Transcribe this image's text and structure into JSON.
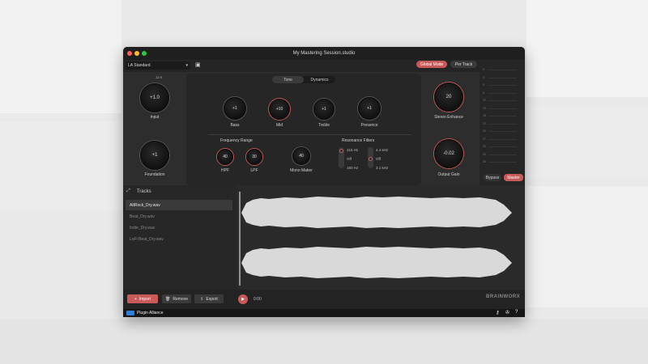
{
  "window": {
    "title": "My Mastering Session.studio"
  },
  "topbar": {
    "preset": "LA Standard",
    "mode_global": "Global Mode",
    "mode_per_track": "Per Track"
  },
  "left": {
    "input": {
      "value": "+1.0",
      "label": "Input",
      "scale": "12.5"
    },
    "foundation": {
      "value": "+1",
      "label": "Foundation"
    }
  },
  "center": {
    "tabs": [
      "Tone",
      "Dynamics"
    ],
    "tone_knobs": [
      {
        "value": "+1",
        "label": "Bass"
      },
      {
        "value": "+10",
        "label": "Mid"
      },
      {
        "value": "+1",
        "label": "Treble"
      },
      {
        "value": "+1",
        "label": "Presence"
      }
    ],
    "frequency_range": {
      "title": "Frequency Range",
      "hpf": {
        "value": "40",
        "label": "HPF"
      },
      "lpf": {
        "value": "30",
        "label": "LPF"
      }
    },
    "mono_maker": {
      "value": "40",
      "label": "Mono Maker"
    },
    "resonance": {
      "title": "Resonance Filters",
      "left_options": [
        "315 Hz",
        "Off",
        "160 Hz"
      ],
      "right_options": [
        "4.4 kHz",
        "Off",
        "3.1 kHz"
      ]
    }
  },
  "right": {
    "stereo_enhance": {
      "value": "20",
      "label": "Stereo Enhance"
    },
    "output_gain": {
      "value": "-0.02",
      "label": "Output Gain"
    }
  },
  "meter": {
    "bypass": "Bypass",
    "master": "Master",
    "scale": [
      "0",
      "3",
      "6",
      "9",
      "12",
      "15",
      "18",
      "21",
      "24",
      "27",
      "30",
      "33",
      "36"
    ]
  },
  "tracks": {
    "title": "Tracks",
    "items": [
      "AltRock_Dry.wav",
      "Beat_Dry.wav",
      "Indie_Dry.wav",
      "LoFi Beat_Dry.wav"
    ]
  },
  "bottom": {
    "import": "Import",
    "remove": "Remove",
    "export": "Export",
    "time": "0:00",
    "brand": "BRAINWORX"
  },
  "footer": {
    "logo": "Plugin Alliance"
  },
  "colors": {
    "accent": "#c85a5a",
    "panel": "#2b2b2b"
  }
}
